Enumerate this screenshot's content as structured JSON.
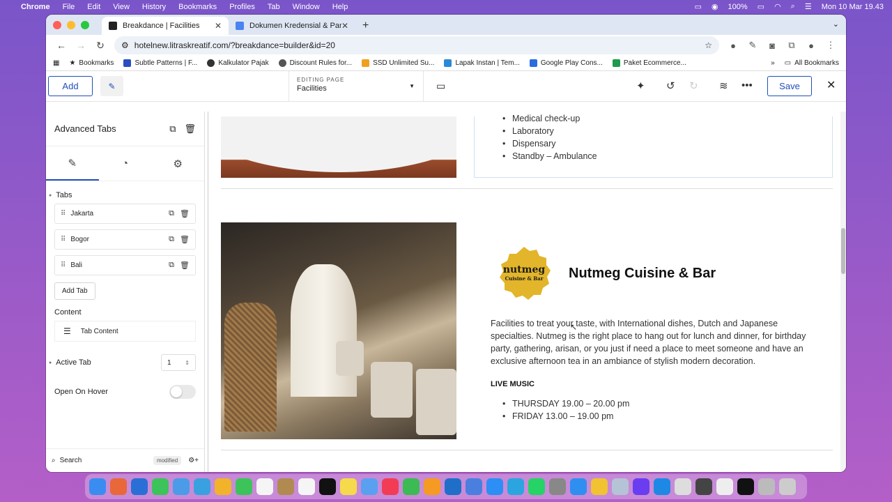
{
  "menubar": {
    "app": "Chrome",
    "items": [
      "File",
      "Edit",
      "View",
      "History",
      "Bookmarks",
      "Profiles",
      "Tab",
      "Window",
      "Help"
    ],
    "battery": "100%",
    "datetime": "Mon 10 Mar 19.43"
  },
  "tabs": [
    {
      "title": "Breakdance | Facilities"
    },
    {
      "title": "Dokumen Kredensial & Pandu"
    }
  ],
  "toolbar": {
    "url": "hotelnew.litraskreatif.com/?breakdance=builder&id=20"
  },
  "bookmarks": [
    "Bookmarks",
    "Subtle Patterns | F...",
    "Kalkulator Pajak",
    "Discount Rules for...",
    "SSD Unlimited Su...",
    "Lapak Instan | Tem...",
    "Google Play Cons...",
    "Paket Ecommerce..."
  ],
  "bookmarks_more": "»",
  "all_bookmarks": "All Bookmarks",
  "builder": {
    "add": "Add",
    "editing_label": "EDITING PAGE",
    "editing_page": "Facilities",
    "save": "Save"
  },
  "sidebar": {
    "title": "Advanced Tabs",
    "tabs_label": "Tabs",
    "items": [
      "Jakarta",
      "Bogor",
      "Bali"
    ],
    "add_tab": "Add Tab",
    "content_label": "Content",
    "tab_content": "Tab Content",
    "active_tab_label": "Active Tab",
    "active_tab_value": "1",
    "hover_label": "Open On Hover",
    "search": "Search",
    "modified": "modified"
  },
  "canvas": {
    "list1": [
      "Medical check-up",
      "Laboratory",
      "Dispensary",
      "Standby – Ambulance"
    ],
    "logo_text": "nutmeg",
    "logo_sub": "Cuisine & Bar",
    "title": "Nutmeg Cuisine & Bar",
    "paragraph": "Facilities to treat your taste, with International dishes, Dutch and Japanese specialties. Nutmeg is the right place to hang out for lunch and dinner, for birthday party, gathering, arisan, or you just if need a place to meet someone and have an exclusive afternoon tea in an ambiance of stylish modern decoration.",
    "live_music": "LIVE MUSIC",
    "schedule": [
      "THURSDAY 19.00 – 20.00 pm",
      "FRIDAY 13.00 – 19.00 pm"
    ]
  },
  "colors": {
    "accent": "#1f4fb8",
    "logo_gold": "#e2b52a"
  }
}
